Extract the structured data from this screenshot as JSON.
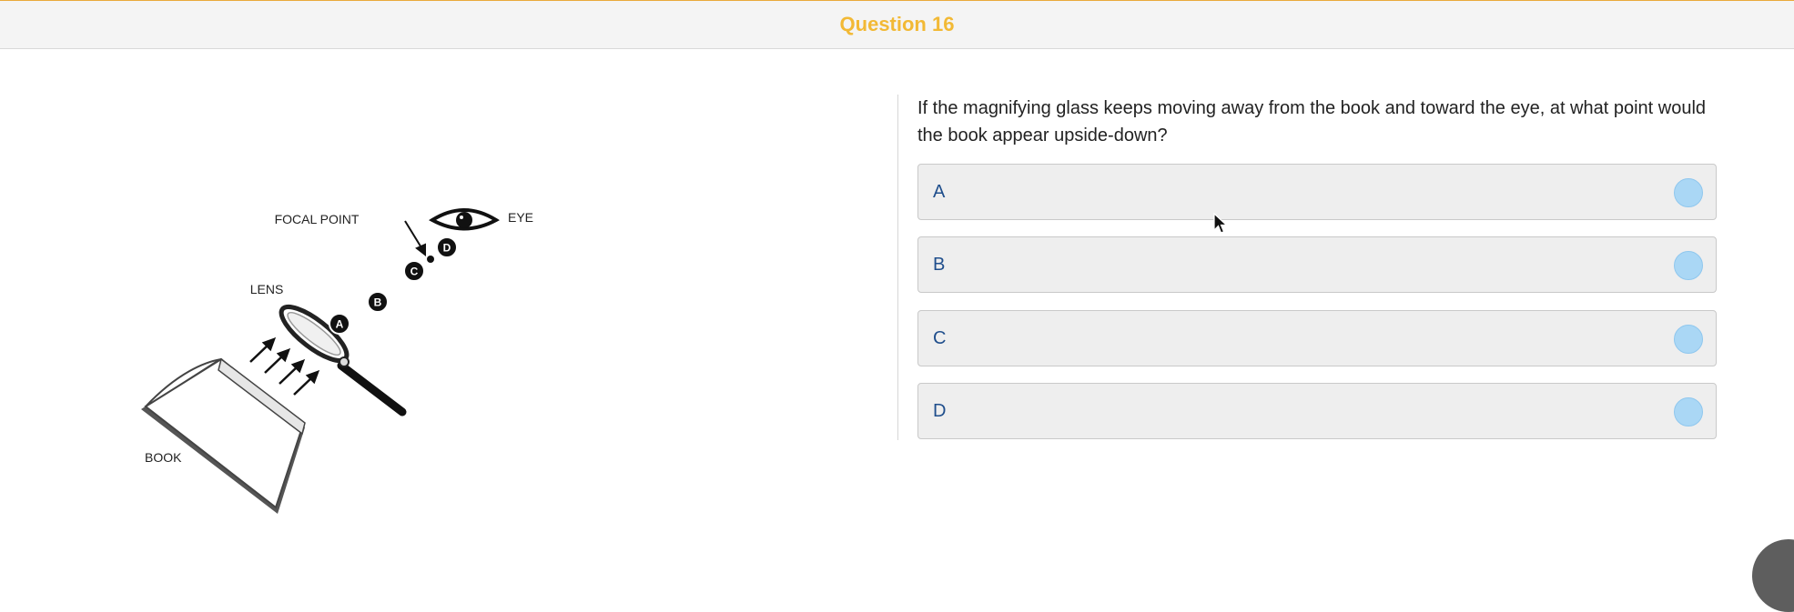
{
  "header": {
    "title": "Question 16"
  },
  "figure": {
    "labels": {
      "focal_point": "FOCAL POINT",
      "eye": "EYE",
      "lens": "LENS",
      "book": "BOOK"
    },
    "markers": [
      "A",
      "B",
      "C",
      "D"
    ]
  },
  "question": {
    "prompt": "If the magnifying glass keeps moving away from the book and toward the eye, at what point would the book appear upside-down?",
    "options": [
      {
        "label": "A"
      },
      {
        "label": "B"
      },
      {
        "label": "C"
      },
      {
        "label": "D"
      }
    ]
  },
  "colors": {
    "title": "#f2b935",
    "header_border": "#e9a93b",
    "option_text": "#1f4e8c",
    "radio_fill": "#aad7f5"
  }
}
